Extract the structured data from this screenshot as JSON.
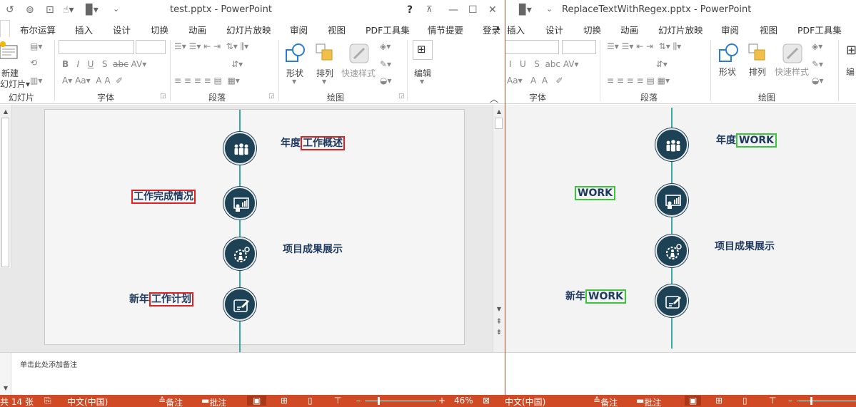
{
  "left": {
    "title": "test.pptx - PowerPoint",
    "help": "?",
    "tabs": [
      "布尔运算",
      "插入",
      "设计",
      "切换",
      "动画",
      "幻灯片放映",
      "审阅",
      "视图",
      "PDF工具集",
      "情节提要",
      "登录"
    ],
    "ribbon": {
      "new_slide": "新建",
      "new_slide2": "幻灯片",
      "grp_slides": "幻灯片",
      "grp_font": "字体",
      "grp_para": "段落",
      "grp_draw": "绘图",
      "shape": "形状",
      "arrange": "排列",
      "quick_style": "快速样式",
      "edit": "编辑",
      "font_btns": [
        "B",
        "I",
        "U",
        "S",
        "abc",
        "AV"
      ],
      "font_size_btns": [
        "A",
        "Aa",
        "A",
        "A"
      ]
    },
    "slide": {
      "items": [
        {
          "prefix": "年度",
          "highlight": "工作概述"
        },
        {
          "prefix": "",
          "highlight": "工作完成情况"
        },
        {
          "prefix": "项目成果展示",
          "highlight": ""
        },
        {
          "prefix": "新年",
          "highlight": "工作计划"
        }
      ]
    },
    "notes_placeholder": "单击此处添加备注",
    "status": {
      "slides": "共 14 张",
      "lang": "中文(中国)",
      "notes": "备注",
      "comments": "批注",
      "zoom": "46%"
    }
  },
  "right": {
    "title": "ReplaceTextWithRegex.pptx - PowerPoint",
    "tabs": [
      "插入",
      "设计",
      "切换",
      "动画",
      "幻灯片放映",
      "审阅",
      "视图",
      "PDF工具集"
    ],
    "ribbon": {
      "grp_font": "字体",
      "grp_para": "段落",
      "grp_draw": "绘图",
      "shape": "形状",
      "arrange": "排列",
      "quick_style": "快速样式",
      "edit": "编"
    },
    "slide": {
      "items": [
        {
          "prefix": "年度",
          "highlight": "WORK"
        },
        {
          "prefix": "",
          "highlight": "WORK"
        },
        {
          "prefix": "项目成果展示",
          "highlight": ""
        },
        {
          "prefix": "新年",
          "highlight": "WORK"
        }
      ]
    },
    "status": {
      "lang": "中文(中国)",
      "notes": "备注",
      "comments": "批注"
    }
  },
  "colors": {
    "status_bar": "#d04a25",
    "circle": "#1e4255",
    "line": "#3aa8a0",
    "highlight_red": "#e02020",
    "highlight_green": "#3cc43c"
  }
}
